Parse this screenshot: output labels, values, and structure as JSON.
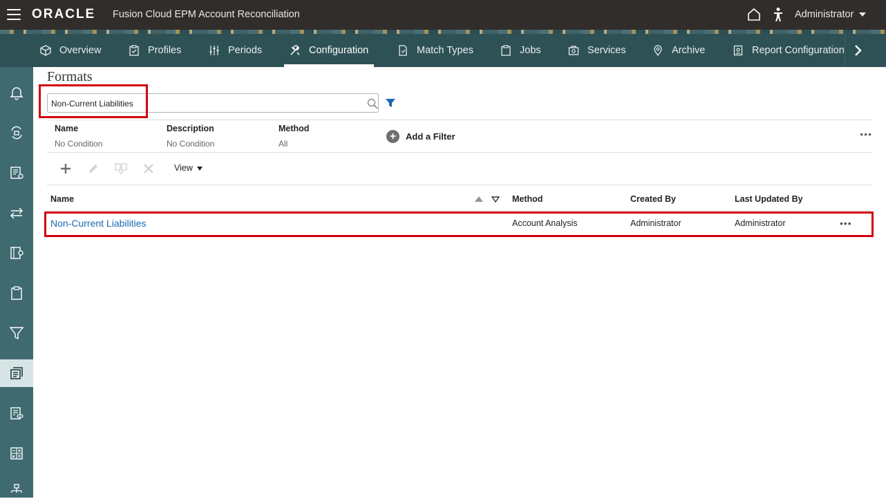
{
  "header": {
    "logo": "ORACLE",
    "app_title": "Fusion Cloud EPM Account Reconciliation",
    "user_name": "Administrator"
  },
  "nav": {
    "tabs": [
      {
        "label": "Overview",
        "icon": "cube-icon"
      },
      {
        "label": "Profiles",
        "icon": "clipboard-check-icon"
      },
      {
        "label": "Periods",
        "icon": "sliders-icon"
      },
      {
        "label": "Configuration",
        "icon": "tools-icon",
        "active": true
      },
      {
        "label": "Match Types",
        "icon": "match-icon"
      },
      {
        "label": "Jobs",
        "icon": "clipboard-icon"
      },
      {
        "label": "Services",
        "icon": "services-icon"
      },
      {
        "label": "Archive",
        "icon": "map-pin-icon"
      },
      {
        "label": "Report Configuration",
        "icon": "report-icon"
      }
    ]
  },
  "sidebar": {
    "items": [
      {
        "icon": "bell-icon"
      },
      {
        "icon": "workflow-icon"
      },
      {
        "icon": "document-settings-icon"
      },
      {
        "icon": "transfer-icon"
      },
      {
        "icon": "report-settings-icon"
      },
      {
        "icon": "clipboard-icon"
      },
      {
        "icon": "filter-icon"
      },
      {
        "icon": "formats-icon",
        "active": true
      },
      {
        "icon": "list-view-icon"
      },
      {
        "icon": "calculator-icon"
      },
      {
        "icon": "hierarchy-icon"
      }
    ]
  },
  "page": {
    "title": "Formats"
  },
  "search": {
    "value": "Non-Current Liabilities"
  },
  "filters": {
    "columns": [
      {
        "label": "Name",
        "value": "No Condition"
      },
      {
        "label": "Description",
        "value": "No Condition"
      },
      {
        "label": "Method",
        "value": "All"
      }
    ],
    "add_label": "Add a Filter",
    "more_label": "•••"
  },
  "toolbar": {
    "view_label": "View"
  },
  "table": {
    "headers": {
      "name": "Name",
      "method": "Method",
      "created_by": "Created By",
      "last_updated_by": "Last Updated By"
    },
    "rows": [
      {
        "name": "Non-Current Liabilities",
        "method": "Account Analysis",
        "created_by": "Administrator",
        "last_updated_by": "Administrator",
        "more": "•••"
      }
    ]
  },
  "colors": {
    "header_bg": "#312d2a",
    "nav_bg": "#2e5155",
    "sidebar_bg": "#3f6a70",
    "link": "#1a69b0",
    "highlight": "#d1000d"
  }
}
